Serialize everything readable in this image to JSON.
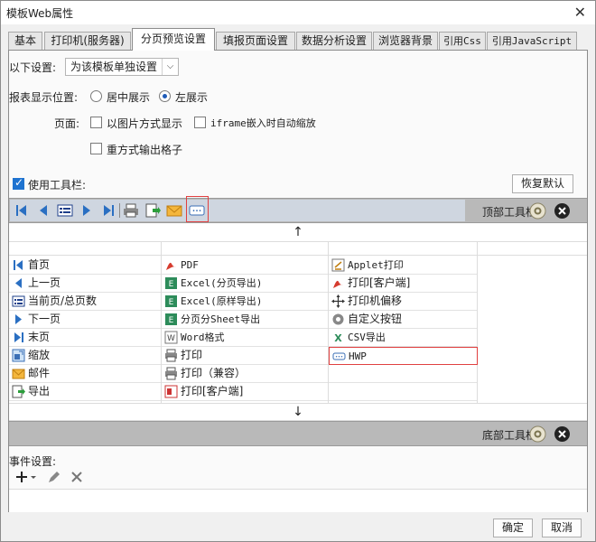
{
  "window": {
    "title": "模板Web属性",
    "close_icon": "close-icon"
  },
  "tabs": [
    {
      "label": "基本",
      "mono": false
    },
    {
      "label": "打印机(服务器)",
      "mono": false
    },
    {
      "label": "分页预览设置",
      "mono": false,
      "active": true
    },
    {
      "label": "填报页面设置",
      "mono": false
    },
    {
      "label": "数据分析设置",
      "mono": false
    },
    {
      "label": "浏览器背景",
      "mono": false
    },
    {
      "label": "引用Css",
      "mono": true
    },
    {
      "label": "引用JavaScript",
      "mono": true
    }
  ],
  "settings": {
    "label": "以下设置:",
    "select_value": "为该模板单独设置"
  },
  "display_position": {
    "label": "报表显示位置:",
    "options": [
      "居中展示",
      "左展示"
    ],
    "selected": 1
  },
  "page": {
    "label": "页面:",
    "option_image": "以图片方式显示",
    "option_iframe": "iframe嵌入时自动缩放",
    "option_reformat": "重方式输出格子"
  },
  "toolbar": {
    "use_label": "使用工具栏:",
    "use_checked": true,
    "restore_label": "恢复默认",
    "top_label": "顶部工具栏",
    "bottom_label": "底部工具栏",
    "arrow_up": "↑",
    "arrow_down": "↓"
  },
  "grid": {
    "col1": [
      {
        "label": "首页",
        "icon": "first-page-icon"
      },
      {
        "label": "上一页",
        "icon": "prev-page-icon"
      },
      {
        "label": "当前页/总页数",
        "icon": "page-count-icon"
      },
      {
        "label": "下一页",
        "icon": "next-page-icon"
      },
      {
        "label": "末页",
        "icon": "last-page-icon"
      },
      {
        "label": "缩放",
        "icon": "zoom-icon"
      },
      {
        "label": "邮件",
        "icon": "mail-icon"
      },
      {
        "label": "导出",
        "icon": "export-icon"
      }
    ],
    "col2": [
      {
        "label": "PDF",
        "icon": "pdf-icon",
        "mono": true
      },
      {
        "label": "Excel(分页导出)",
        "icon": "excel-icon",
        "mono": true
      },
      {
        "label": "Excel(原样导出)",
        "icon": "excel-icon",
        "mono": true
      },
      {
        "label": "分页分Sheet导出",
        "icon": "excel-icon",
        "mono": true
      },
      {
        "label": "Word格式",
        "icon": "word-icon",
        "mono": true
      },
      {
        "label": "打印",
        "icon": "print-icon",
        "mono": false
      },
      {
        "label": "打印（兼容）",
        "icon": "print-icon",
        "mono": false
      },
      {
        "label": "打印[客户端]",
        "icon": "print-client-icon",
        "mono": false
      }
    ],
    "col3": [
      {
        "label": "Applet打印",
        "icon": "applet-print-icon",
        "mono": true
      },
      {
        "label": "打印[客户端]",
        "icon": "print-client-icon",
        "mono": false
      },
      {
        "label": "打印机偏移",
        "icon": "move-icon",
        "mono": false
      },
      {
        "label": "自定义按钮",
        "icon": "gear-icon",
        "mono": false
      },
      {
        "label": "CSV导出",
        "icon": "csv-icon",
        "mono": true
      },
      {
        "label": "HWP",
        "icon": "hwp-icon",
        "mono": true,
        "highlight": true
      }
    ]
  },
  "events": {
    "label": "事件设置:"
  },
  "footer": {
    "ok": "确定",
    "cancel": "取消"
  }
}
